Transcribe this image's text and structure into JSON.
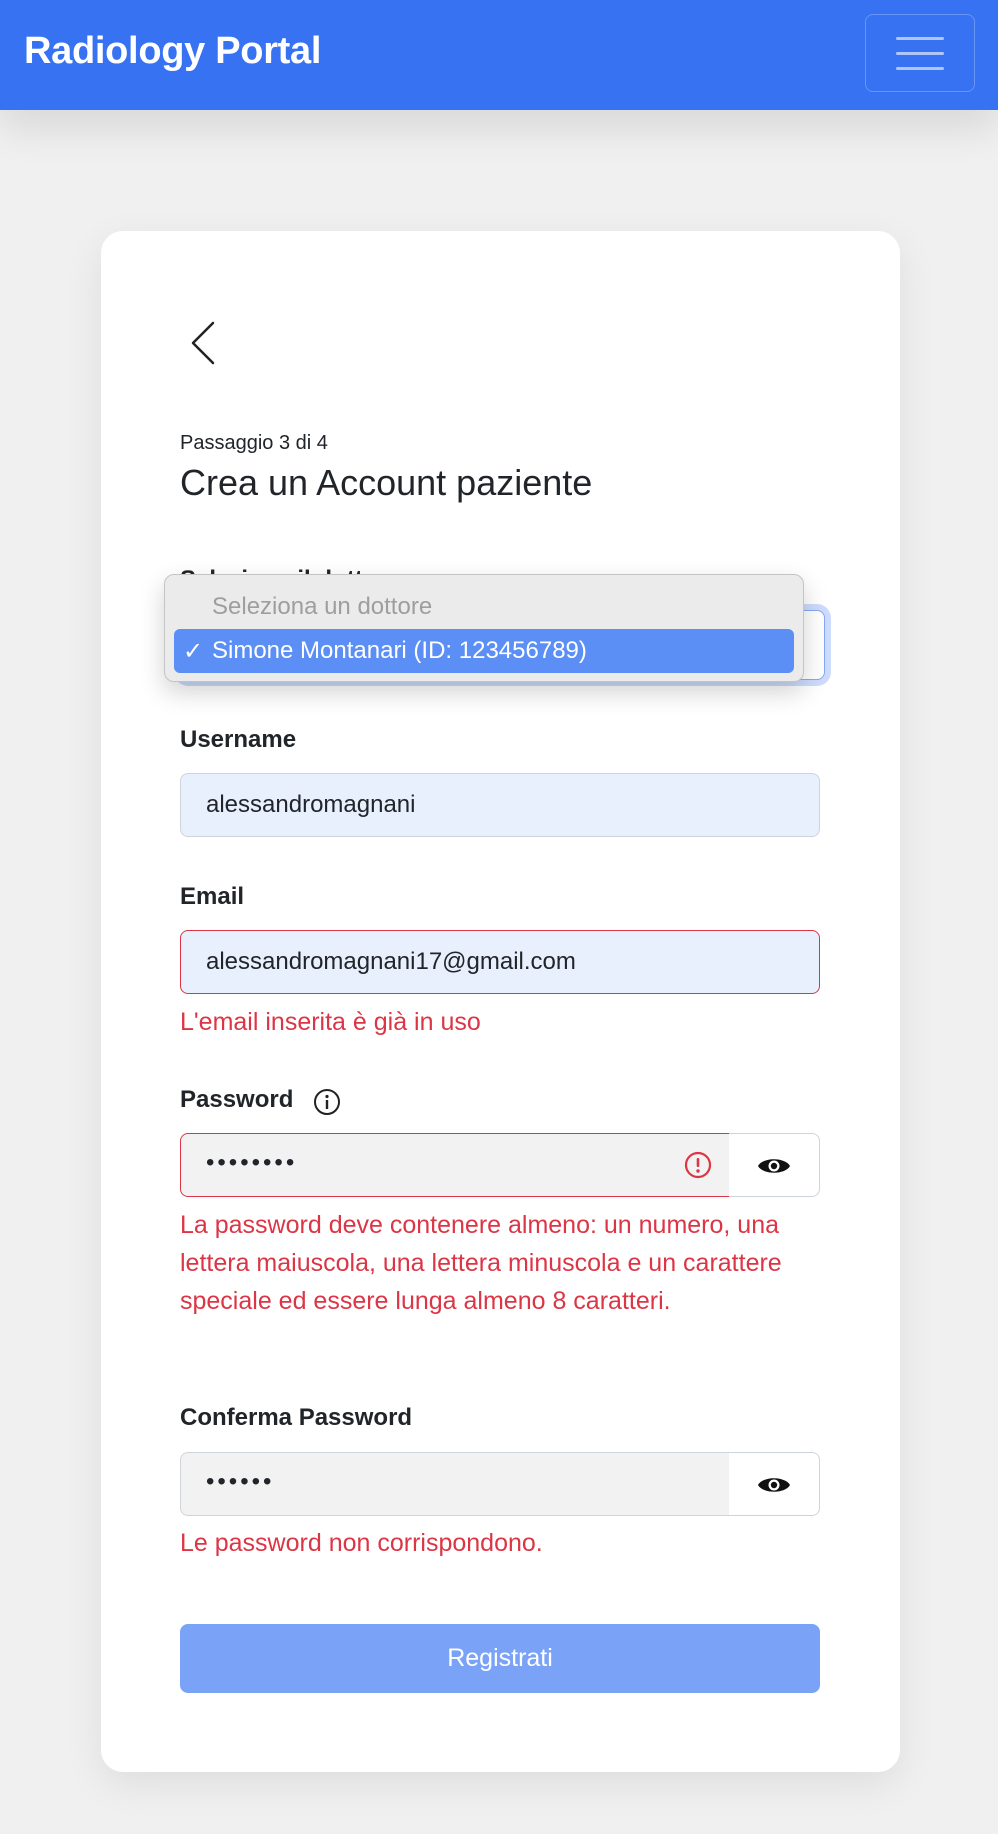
{
  "navbar": {
    "brand": "Radiology Portal",
    "menu_icon": "hamburger-icon",
    "background": "#3672f2"
  },
  "form": {
    "back_icon": "chevron-left-icon",
    "step": "Passaggio 3 di 4",
    "title": "Crea un Account paziente",
    "doctor_select": {
      "label": "Seleziona il dottore",
      "options": [
        {
          "label": "Seleziona un dottore",
          "disabled": true
        },
        {
          "label": "Simone Montanari (ID: 123456789)",
          "selected": true
        }
      ],
      "check": "✓"
    },
    "username": {
      "label": "Username",
      "value": "alessandromagnani"
    },
    "email": {
      "label": "Email",
      "value": "alessandromagnani17@gmail.com",
      "error": "L'email inserita è già in uso"
    },
    "password": {
      "label": "Password",
      "info_icon": "info-circle-icon",
      "value": "••••••••",
      "error_icon": "exclamation-circle-icon",
      "toggle_icon": "eye-icon",
      "error": "La password deve contenere almeno: un numero, una lettera maiuscola, una lettera minuscola e un carattere speciale ed essere lunga almeno 8 caratteri."
    },
    "confirm_password": {
      "label": "Conferma Password",
      "value": "••••••",
      "toggle_icon": "eye-icon",
      "error": "Le password non corrispondono."
    },
    "submit_label": "Registrati"
  },
  "colors": {
    "accent": "#3672f2",
    "error": "#dc3545",
    "submit_disabled": "#7aa2f7",
    "autofill": "#e8f0fe"
  }
}
